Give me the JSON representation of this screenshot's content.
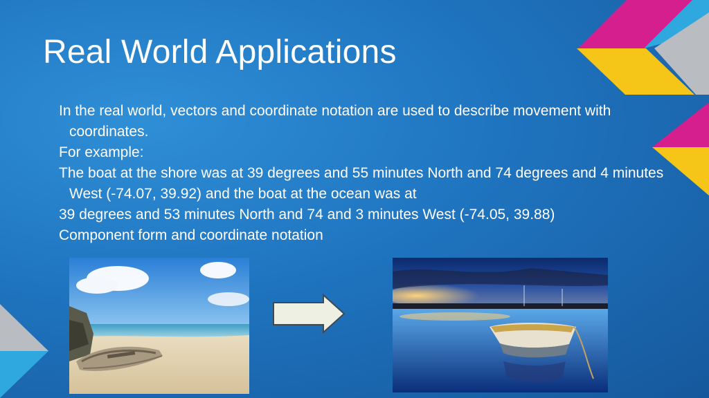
{
  "slide": {
    "title": "Real World Applications",
    "paragraphs": [
      "In the real world, vectors and coordinate notation are used to describe movement with coordinates.",
      "For example:",
      "The boat at the shore was at 39 degrees and 55 minutes North and 74 degrees and 4 minutes West (-74.07, 39.92) and the boat at the ocean was at",
      "39 degrees  and 53 minutes North and 74 and 3 minutes West (-74.05, 39.88)",
      "Component form and coordinate notation"
    ]
  },
  "colors": {
    "background": "#1f74bf",
    "accent_magenta": "#d61f8f",
    "accent_yellow": "#f5c518",
    "accent_gray": "#b9bcc0",
    "accent_cyan": "#2fa8e0"
  },
  "images": {
    "beach": "beach-boat-photo",
    "ocean": "ocean-boat-photo",
    "arrow": "right-arrow-icon"
  }
}
